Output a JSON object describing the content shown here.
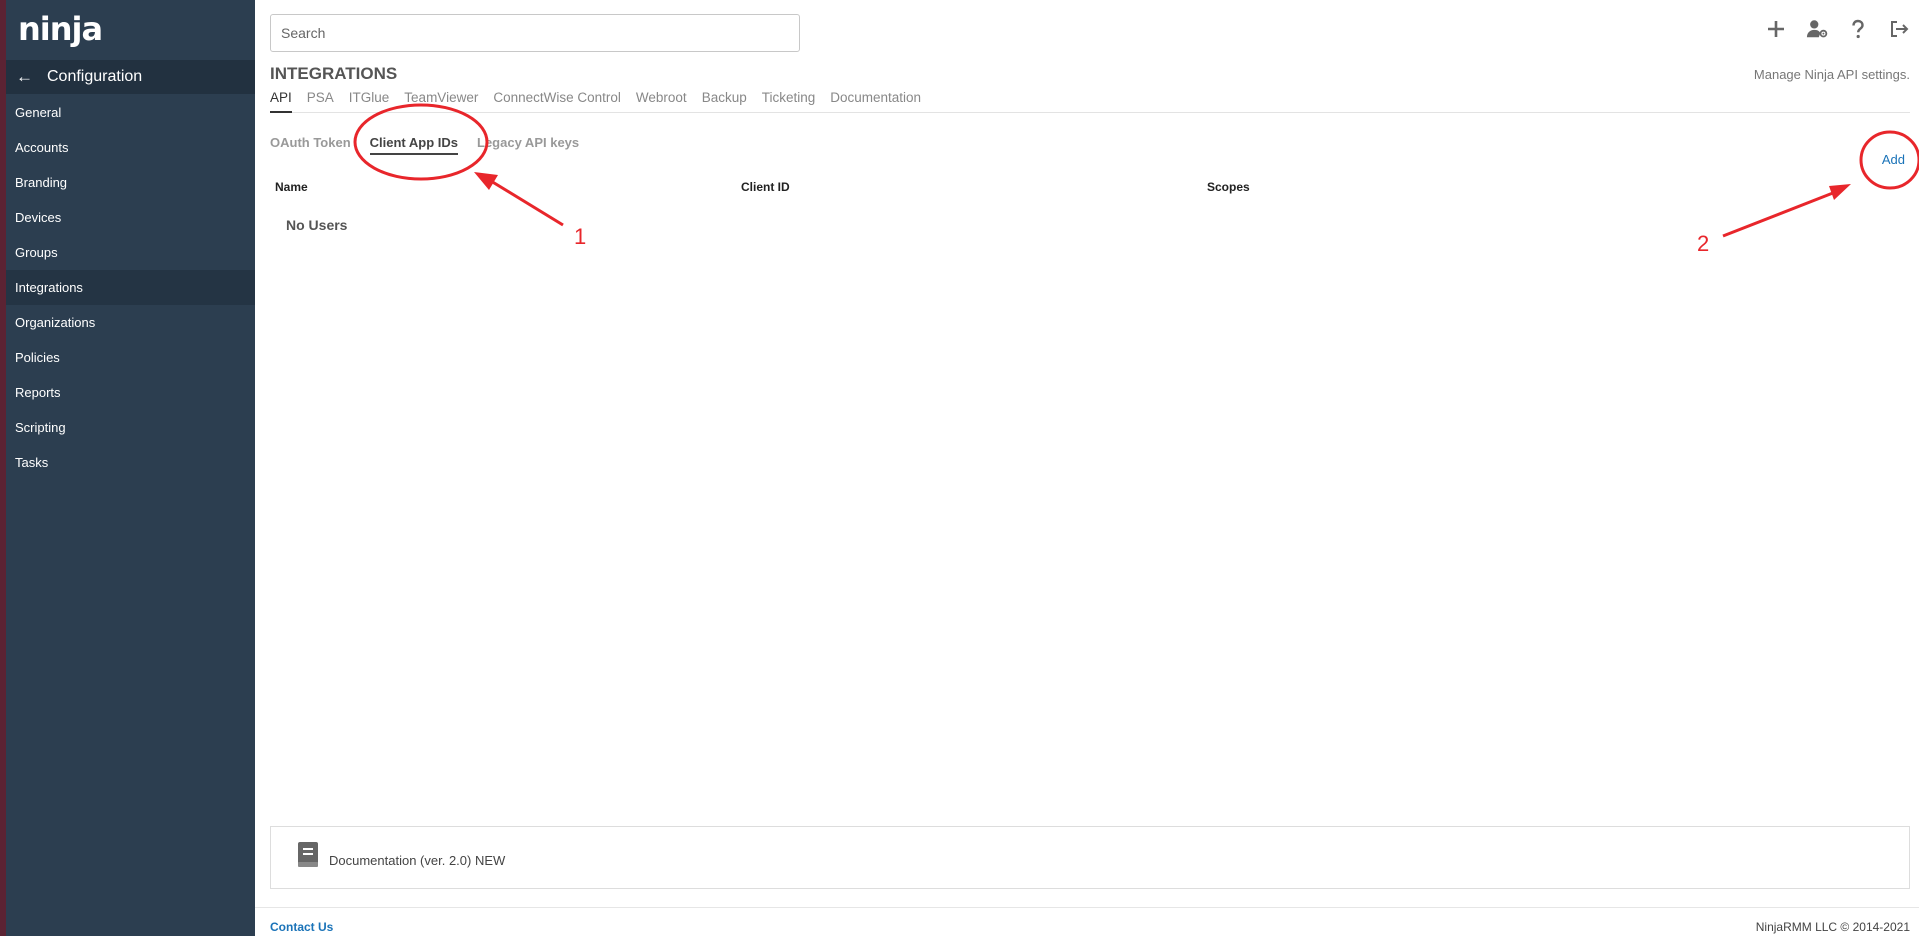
{
  "sidebar": {
    "logo": "ninja",
    "config_title": "Configuration",
    "items": [
      {
        "label": "General"
      },
      {
        "label": "Accounts"
      },
      {
        "label": "Branding"
      },
      {
        "label": "Devices"
      },
      {
        "label": "Groups"
      },
      {
        "label": "Integrations",
        "active": true
      },
      {
        "label": "Organizations"
      },
      {
        "label": "Policies"
      },
      {
        "label": "Reports"
      },
      {
        "label": "Scripting"
      },
      {
        "label": "Tasks"
      }
    ]
  },
  "header": {
    "search_placeholder": "Search",
    "icons": [
      "plus-icon",
      "user-settings-icon",
      "help-icon",
      "logout-icon"
    ]
  },
  "page": {
    "title": "INTEGRATIONS",
    "subtitle": "Manage Ninja API settings.",
    "tabs": [
      {
        "label": "API",
        "active": true
      },
      {
        "label": "PSA"
      },
      {
        "label": "ITGlue"
      },
      {
        "label": "TeamViewer"
      },
      {
        "label": "ConnectWise Control"
      },
      {
        "label": "Webroot"
      },
      {
        "label": "Backup"
      },
      {
        "label": "Ticketing"
      },
      {
        "label": "Documentation"
      }
    ],
    "subtabs": [
      {
        "label": "OAuth Token"
      },
      {
        "label": "Client App IDs",
        "active": true
      },
      {
        "label": "Legacy API keys"
      }
    ],
    "add_label": "Add",
    "table": {
      "columns": [
        "Name",
        "Client ID",
        "Scopes"
      ],
      "empty_text": "No Users"
    },
    "documentation_link": "Documentation (ver. 2.0) NEW"
  },
  "footer": {
    "contact": "Contact Us",
    "copyright": "NinjaRMM LLC © 2014-2021"
  },
  "annotations": {
    "color": "#e8262b",
    "labels": [
      "1",
      "2"
    ]
  }
}
